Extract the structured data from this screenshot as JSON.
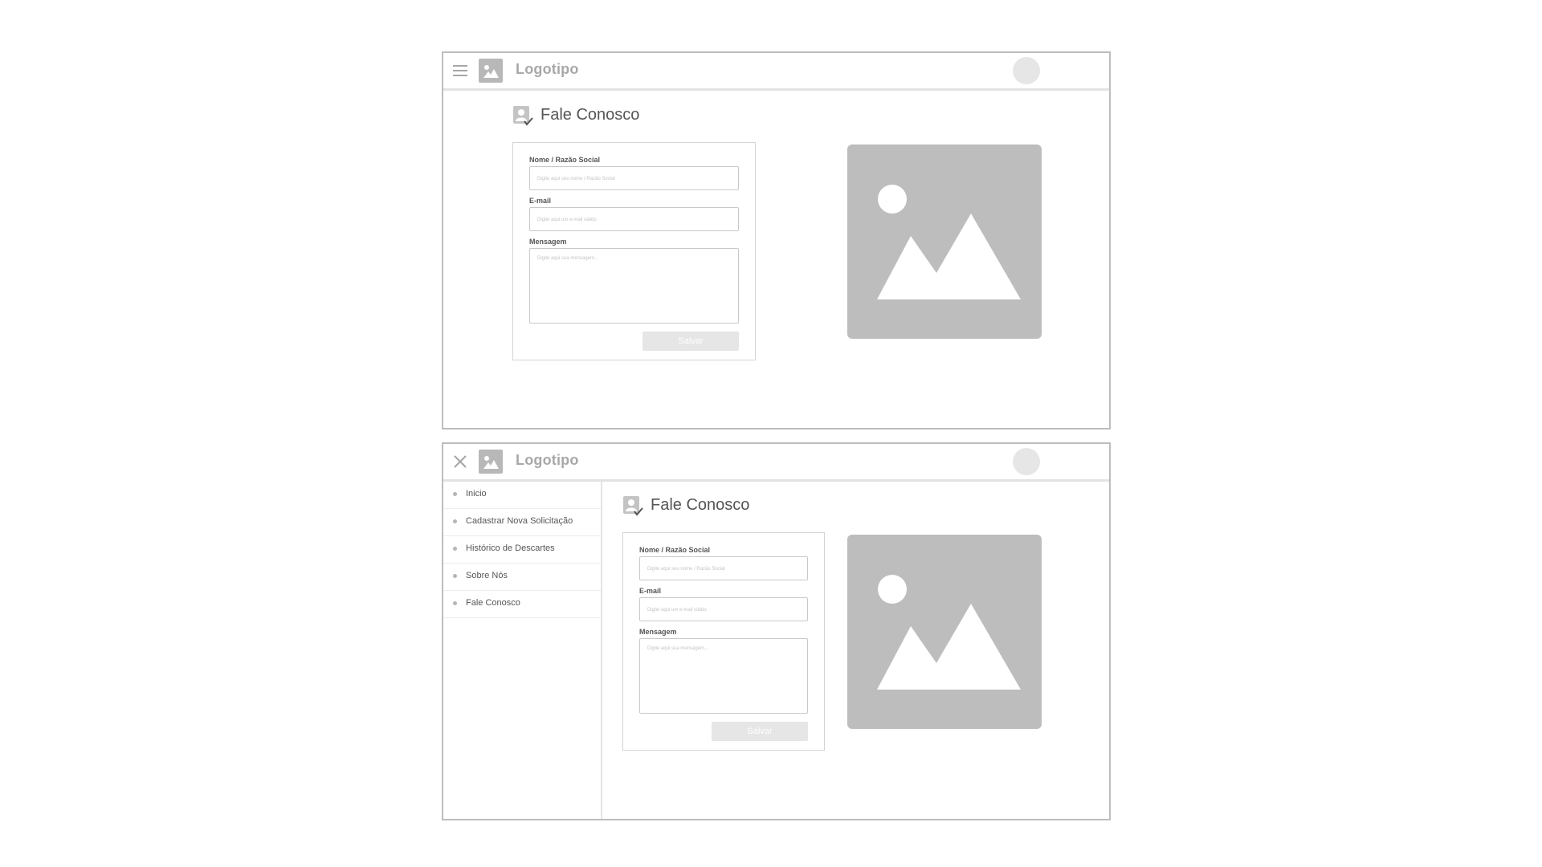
{
  "header": {
    "logo_text": "Logotipo"
  },
  "page": {
    "title": "Fale Conosco"
  },
  "form": {
    "name_label": "Nome / Razão Social",
    "name_placeholder": "Digite aqui seu nome / Razão Social",
    "email_label": "E-mail",
    "email_placeholder": "Digite aqui um e-mail válido",
    "message_label": "Mensagem",
    "message_placeholder": "Digite aqui sua mensagem...",
    "save_label": "Salvar"
  },
  "sidebar": {
    "items": [
      {
        "label": "Inicio"
      },
      {
        "label": "Cadastrar Nova Solicitação"
      },
      {
        "label": "Histórico de Descartes"
      },
      {
        "label": "Sobre Nós"
      },
      {
        "label": "Fale Conosco"
      }
    ]
  },
  "colors": {
    "placeholder_gray": "#bdbdbd",
    "border_gray": "#bdbdbd",
    "button_disabled": "#e6e6e6"
  },
  "icons": [
    "menu-icon",
    "close-icon",
    "logo-image-icon",
    "avatar",
    "contact-book-icon",
    "image-placeholder-icon"
  ]
}
